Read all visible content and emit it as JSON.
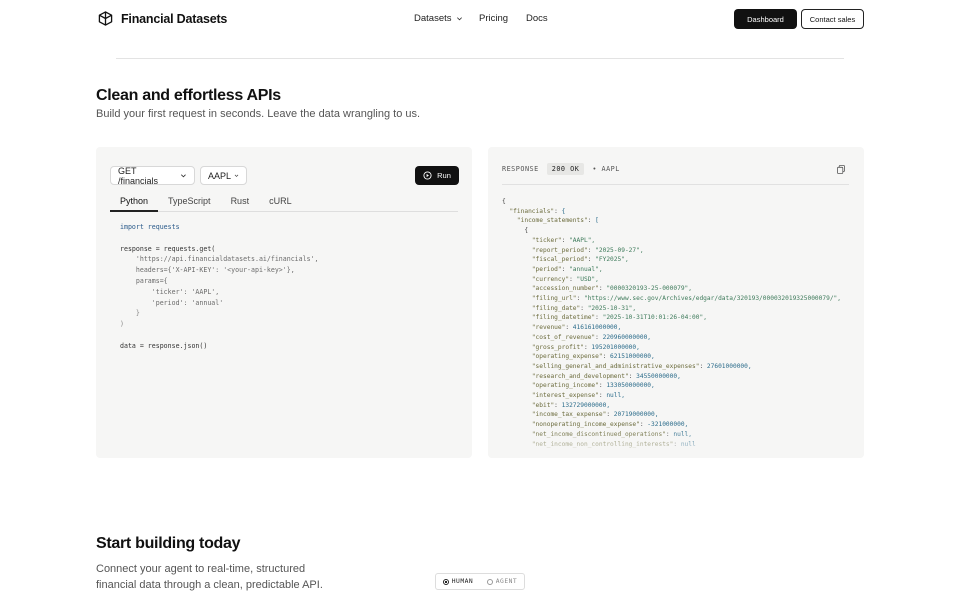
{
  "nav": {
    "brand": "Financial Datasets",
    "menu": [
      {
        "label": "Datasets"
      },
      {
        "label": "Pricing"
      },
      {
        "label": "Docs"
      }
    ],
    "dashboard_label": "Dashboard",
    "contact_label": "Contact sales"
  },
  "hero": {
    "title": "Clean and effortless APIs",
    "subtitle": "Build your first request in seconds. Leave the data wrangling to us."
  },
  "request": {
    "method_endpoint": "GET /financials",
    "ticker": "AAPL",
    "run_label": "Run",
    "tabs": [
      "Python",
      "TypeScript",
      "Rust",
      "cURL"
    ],
    "active_tab": "Python",
    "code": {
      "l1": "import requests",
      "l2": "response = requests.get(",
      "l3": "    'https://api.financialdatasets.ai/financials',",
      "l4": "    headers={'X-API-KEY': '<your-api-key>'},",
      "l5": "    params={",
      "l6": "        'ticker': 'AAPL',",
      "l7": "        'period': 'annual'",
      "l8": "    }",
      "l9": ")",
      "l10": "data = response.json()"
    }
  },
  "response": {
    "label": "RESPONSE",
    "status": "200 OK",
    "ticker": "• AAPL",
    "lines": [
      "{",
      "  \"financials\": {",
      "    \"income_statements\": [",
      "      {",
      "        \"ticker\": \"AAPL\",",
      "        \"report_period\": \"2025-09-27\",",
      "        \"fiscal_period\": \"FY2025\",",
      "        \"period\": \"annual\",",
      "        \"currency\": \"USD\",",
      "        \"accession_number\": \"0000320193-25-000079\",",
      "        \"filing_url\": \"https://www.sec.gov/Archives/edgar/data/320193/000032019325000079/\",",
      "        \"filing_date\": \"2025-10-31\",",
      "        \"filing_datetime\": \"2025-10-31T10:01:26-04:00\",",
      "        \"revenue\": 416161000000,",
      "        \"cost_of_revenue\": 220960000000,",
      "        \"gross_profit\": 195201000000,",
      "        \"operating_expense\": 62151000000,",
      "        \"selling_general_and_administrative_expenses\": 27601000000,",
      "        \"research_and_development\": 34550000000,",
      "        \"operating_income\": 133050000000,",
      "        \"interest_expense\": null,",
      "        \"ebit\": 132729000000,",
      "        \"income_tax_expense\": 20719000000,",
      "        \"nonoperating_income_expense\": -321000000,",
      "        \"net_income_discontinued_operations\": null,",
      "        \"net_income_non_controlling_interests\": null"
    ]
  },
  "cta": {
    "title": "Start building today",
    "subtitle": "Connect your agent to real-time, structured financial data through a clean, predictable API.",
    "toggle_human": "HUMAN",
    "toggle_agent": "AGENT",
    "selected": "HUMAN"
  },
  "icons": [
    "cube-logo-icon",
    "chevron-down-icon",
    "play-circle-icon",
    "copy-icon",
    "radio-icon"
  ]
}
